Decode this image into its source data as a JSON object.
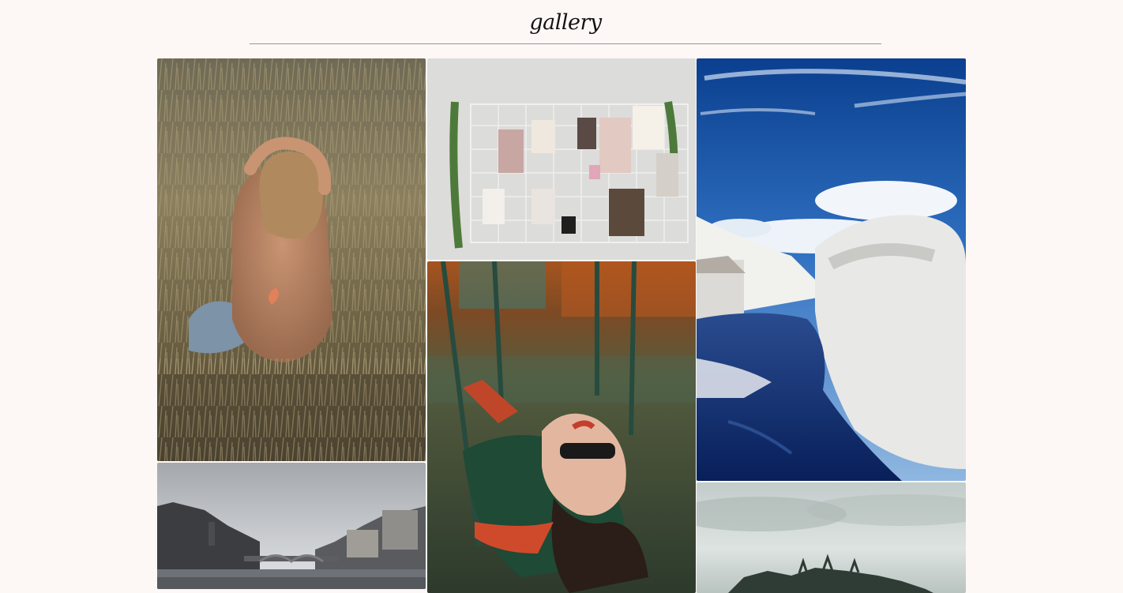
{
  "page": {
    "title": "gallery"
  },
  "gallery": {
    "photos": [
      {
        "subject": "woman-in-wheat-field"
      },
      {
        "subject": "mood-board-wall"
      },
      {
        "subject": "infrared-river-landscape"
      },
      {
        "subject": "girl-on-swing"
      },
      {
        "subject": "city-river-bridge"
      },
      {
        "subject": "misty-forest"
      }
    ]
  },
  "colors": {
    "background": "#fdf8f6",
    "divider": "#9a9594",
    "title": "#141414"
  }
}
